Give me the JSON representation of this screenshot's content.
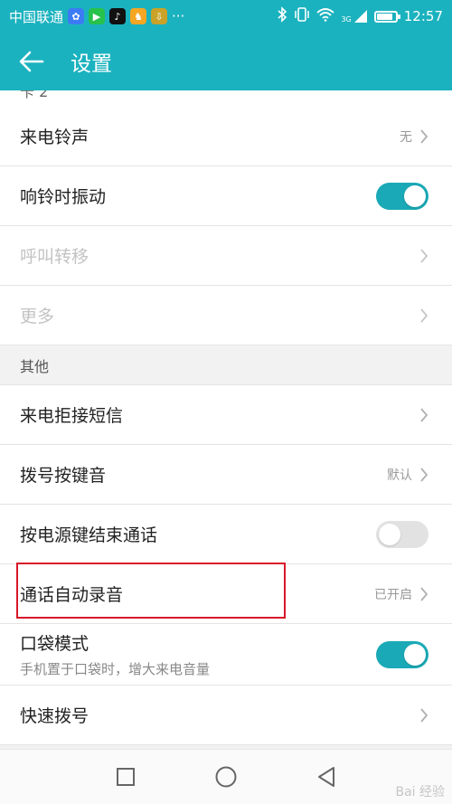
{
  "status_bar": {
    "carrier": "中国联通",
    "dots": "···",
    "network": "3G",
    "time": "12:57",
    "battery_level": 0.85
  },
  "app_bar": {
    "title": "设置"
  },
  "partial_section": "卡 2",
  "rows_top": [
    {
      "label": "来电铃声",
      "value": "无"
    },
    {
      "label": "响铃时振动",
      "toggle": "on"
    },
    {
      "label": "呼叫转移"
    },
    {
      "label": "更多"
    }
  ],
  "section_other": "其他",
  "rows_other": [
    {
      "label": "来电拒接短信"
    },
    {
      "label": "拨号按键音",
      "value": "默认"
    },
    {
      "label": "按电源键结束通话",
      "toggle": "off"
    },
    {
      "label": "通话自动录音",
      "value": "已开启"
    },
    {
      "label": "口袋模式",
      "sub": "手机置于口袋时，增大来电音量",
      "toggle": "on"
    },
    {
      "label": "快速拨号"
    }
  ],
  "watermark": "Bai 经验",
  "colors": {
    "accent": "#1bb2bf",
    "toggle_on": "#1aa9b6",
    "highlight": "#d8182b"
  }
}
